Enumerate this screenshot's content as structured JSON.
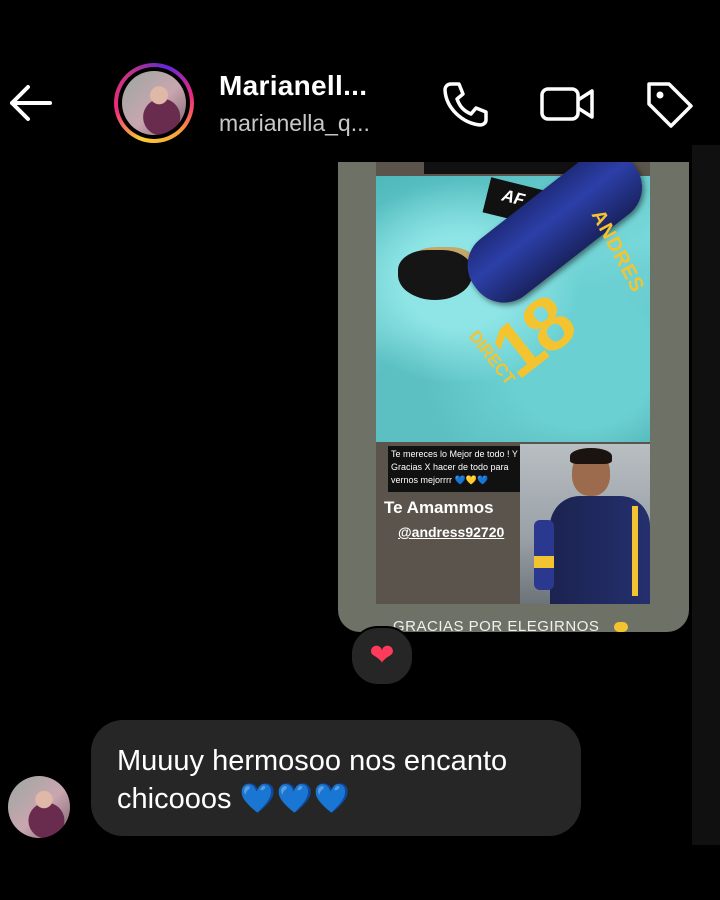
{
  "header": {
    "name": "Marianell...",
    "username": "marianella_q...",
    "back_icon": "arrow-left-icon",
    "call_icon": "phone-icon",
    "video_icon": "video-camera-icon",
    "tag_icon": "tag-icon"
  },
  "story": {
    "overlay_text": "Te mereces lo Mejor de todo ! Y Gracias X hacer de todo para vernos mejorrrr",
    "overlay_hearts": "💙💛💙",
    "title": "Te Amammos",
    "mention": "@andress92720",
    "number": "18",
    "product_name": "ANDRES",
    "product_word": "DIRECT",
    "logo": "AF",
    "footer": "GRACIAS POR ELEGIRNOS"
  },
  "reaction": {
    "emoji": "❤",
    "icon": "heart-reaction-icon"
  },
  "message": {
    "text": "Muuuy hermosoo nos encanto chicooos",
    "hearts": "💙💙💙"
  },
  "colors": {
    "background": "#000000",
    "bubble": "#262626",
    "accent_blue": "#1e8fff",
    "reaction_red": "#ff3b5c"
  }
}
